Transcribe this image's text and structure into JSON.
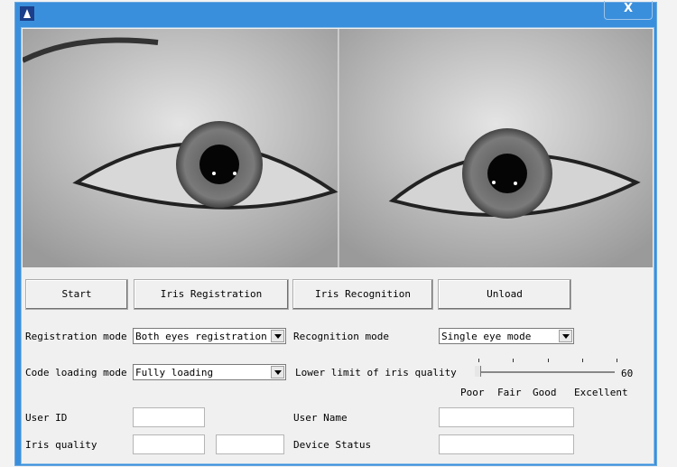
{
  "window": {
    "close_label": "X",
    "app_icon": "iris-app-icon"
  },
  "buttons": {
    "start": "Start",
    "iris_registration": "Iris Registration",
    "iris_recognition": "Iris Recognition",
    "unload": "Unload"
  },
  "registration_mode": {
    "label": "Registration mode",
    "value": "Both eyes registration"
  },
  "recognition_mode": {
    "label": "Recognition mode",
    "value": "Single eye mode"
  },
  "code_loading_mode": {
    "label": "Code loading mode",
    "value": "Fully loading"
  },
  "quality_slider": {
    "label": "Lower limit of iris quality",
    "value": 60,
    "scale_labels": [
      "Poor",
      "Fair",
      "Good",
      "Excellent"
    ]
  },
  "fields": {
    "user_id": {
      "label": "User ID",
      "value": ""
    },
    "user_name": {
      "label": "User Name",
      "value": ""
    },
    "iris_quality": {
      "label": "Iris quality",
      "value1": "",
      "value2": ""
    },
    "device_status": {
      "label": "Device Status",
      "value": ""
    }
  }
}
